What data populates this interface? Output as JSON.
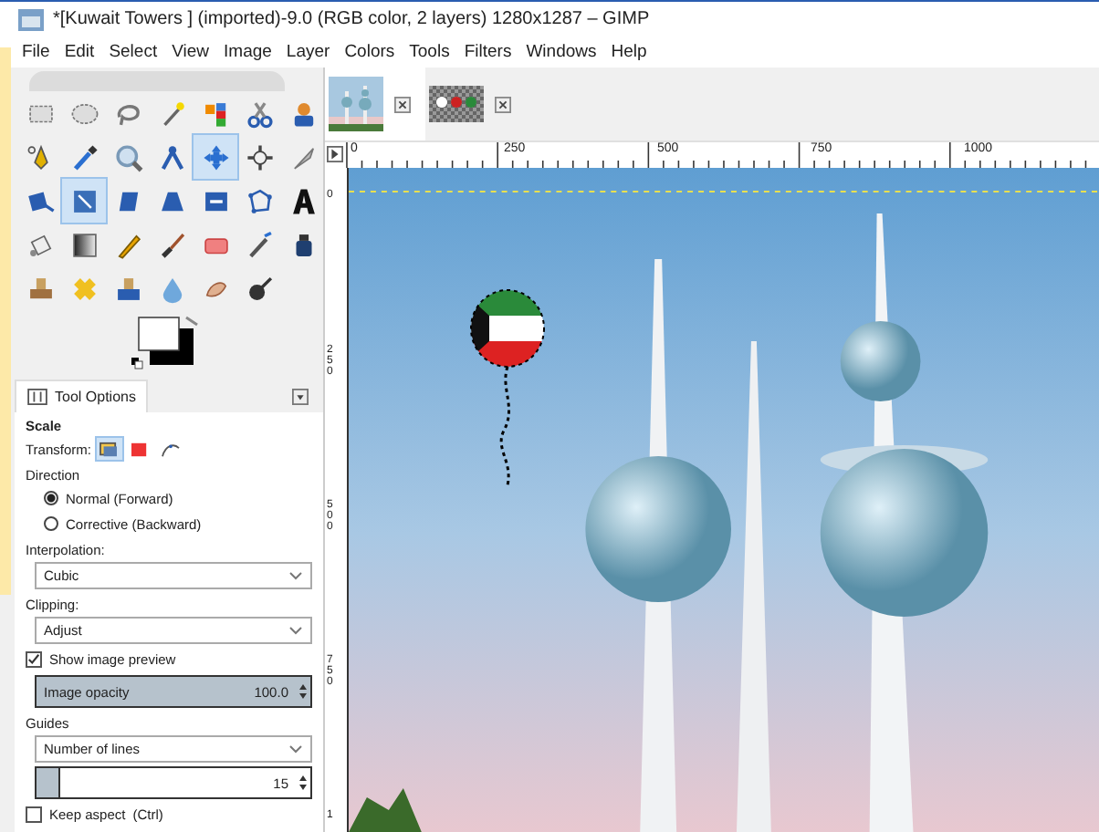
{
  "window": {
    "title": "*[Kuwait Towers ] (imported)-9.0 (RGB color, 2 layers) 1280x1287 – GIMP"
  },
  "menu": [
    "File",
    "Edit",
    "Select",
    "View",
    "Image",
    "Layer",
    "Colors",
    "Tools",
    "Filters",
    "Windows",
    "Help"
  ],
  "image_tabs": [
    {
      "kind": "photo",
      "selected": true
    },
    {
      "kind": "layers",
      "selected": false
    }
  ],
  "toolbox": {
    "tools": [
      {
        "selected": false
      },
      {
        "selected": false
      },
      {
        "selected": false
      },
      {
        "selected": false
      },
      {
        "selected": false
      },
      {
        "selected": false
      },
      {
        "selected": false
      },
      {
        "selected": false
      },
      {
        "selected": false
      },
      {
        "selected": false
      },
      {
        "selected": false
      },
      {
        "selected": true
      },
      {
        "selected": false
      },
      {
        "selected": false
      },
      {
        "selected": false
      },
      {
        "selected": true
      },
      {
        "selected": false
      },
      {
        "selected": false
      },
      {
        "selected": false
      },
      {
        "selected": false
      },
      {
        "selected": false
      },
      {
        "selected": false
      },
      {
        "selected": false
      },
      {
        "selected": false
      },
      {
        "selected": false
      },
      {
        "selected": false
      },
      {
        "selected": false
      },
      {
        "selected": false
      },
      {
        "selected": false
      },
      {
        "selected": false
      },
      {
        "selected": false
      },
      {
        "selected": false
      },
      {
        "selected": false
      },
      {
        "selected": false
      }
    ]
  },
  "tool_options": {
    "tab_label": "Tool Options",
    "tool": "Scale",
    "transform_label": "Transform:",
    "transform_modes": [
      {
        "kind": "layer",
        "selected": true
      },
      {
        "kind": "selection",
        "selected": false
      },
      {
        "kind": "path",
        "selected": false
      }
    ],
    "direction_label": "Direction",
    "directions": [
      {
        "label": "Normal (Forward)",
        "selected": true
      },
      {
        "label": "Corrective (Backward)",
        "selected": false
      }
    ],
    "interpolation": {
      "label": "Interpolation:",
      "value": "Cubic"
    },
    "clipping": {
      "label": "Clipping:",
      "value": "Adjust"
    },
    "show_preview": {
      "label": "Show image preview",
      "checked": true
    },
    "image_opacity": {
      "label": "Image opacity",
      "value": "100.0",
      "level": 1
    },
    "guides": {
      "label": "Guides",
      "value": "Number of lines"
    },
    "lines": {
      "value": "15",
      "level": 0.08
    },
    "keep_aspect": {
      "label": "Keep aspect",
      "shortcut": "(Ctrl)",
      "checked": false
    }
  },
  "rulers": {
    "horizontal": [
      "0",
      "250",
      "500",
      "750",
      "1000"
    ],
    "vertical": [
      "0",
      "250",
      "500",
      "750",
      "1"
    ]
  }
}
